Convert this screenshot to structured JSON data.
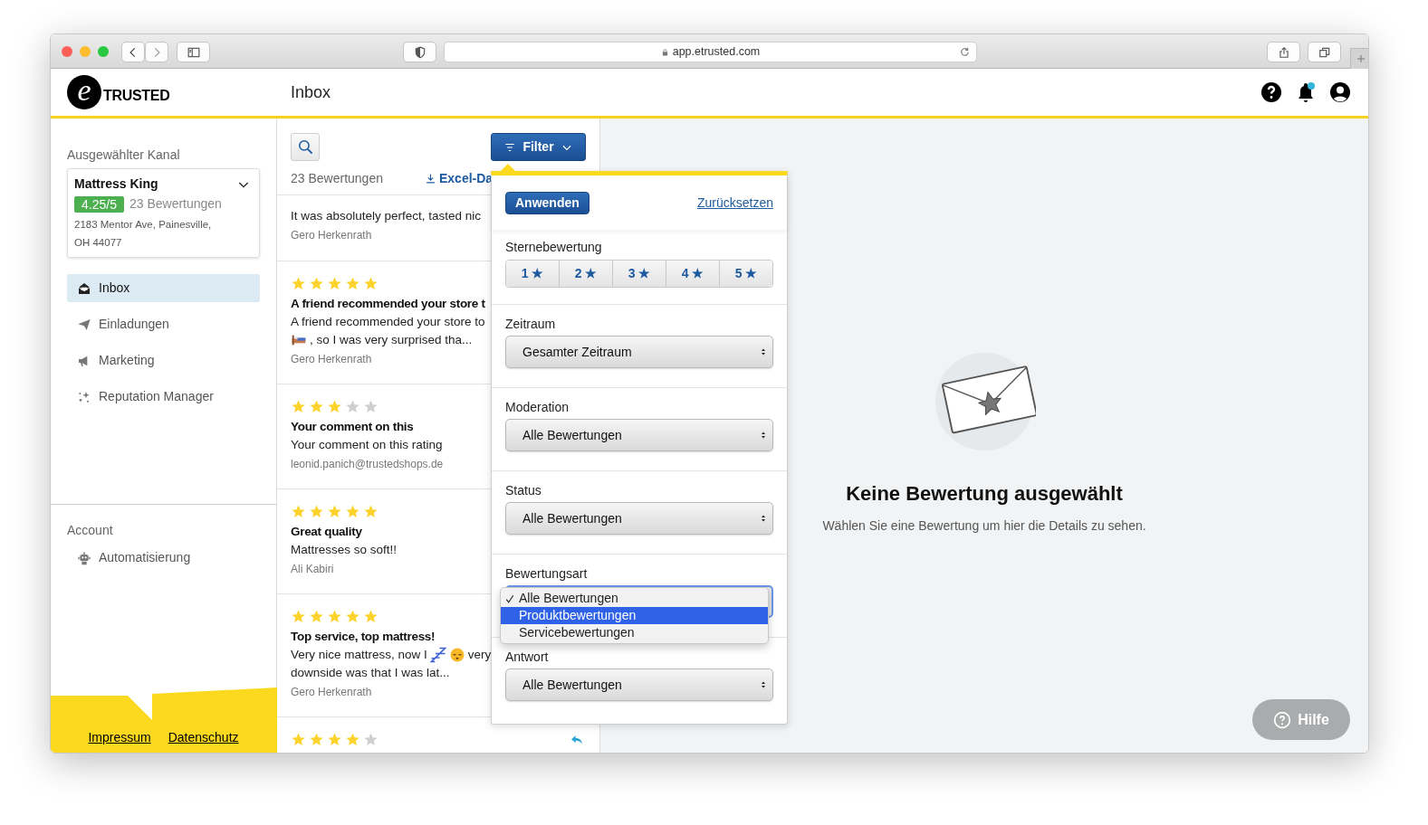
{
  "browser": {
    "url": "app.etrusted.com"
  },
  "header": {
    "logo": {
      "mark": "e",
      "text": "TRUSTED"
    },
    "title": "Inbox",
    "notification": true
  },
  "sidebar": {
    "channel_label": "Ausgewählter Kanal",
    "channel": {
      "name": "Mattress King",
      "rating": "4.25/5",
      "count": "23 Bewertungen",
      "address": "2183 Mentor Ave, Painesville, OH 44077"
    },
    "nav": [
      {
        "label": "Inbox",
        "selected": true
      },
      {
        "label": "Einladungen",
        "selected": false
      },
      {
        "label": "Marketing",
        "selected": false
      },
      {
        "label": "Reputation Manager",
        "selected": false
      }
    ],
    "account_label": "Account",
    "account_nav": [
      {
        "label": "Automatisierung",
        "selected": false
      }
    ],
    "footer_links": [
      "Impressum",
      "Datenschutz"
    ]
  },
  "review_list": {
    "count": "23 Bewertungen",
    "export_link": "Excel-Da",
    "filter_button": "Filter",
    "reviews": [
      {
        "body": [
          [
            {
              "text": "It was absolutely perfect, tasted nic"
            }
          ]
        ],
        "author": "Gero Herkenrath",
        "replied": false
      },
      {
        "stars": 5,
        "title": "A friend recommended your store t",
        "body": [
          [
            {
              "text": "A friend recommended your store to"
            }
          ],
          [
            {
              "kind": "emoji"
            },
            {
              "text": ", so I was very surprised tha..."
            }
          ]
        ],
        "author": "Gero Herkenrath",
        "replied": false
      },
      {
        "stars": 3,
        "title": "Your comment on this",
        "body": [
          [
            {
              "text": "Your comment on this rating"
            }
          ]
        ],
        "author": "leonid.panich@trustedshops.de",
        "replied": false
      },
      {
        "stars": 5,
        "title": "Great quality",
        "body": [
          [
            {
              "text": "Mattresses so soft!!"
            }
          ]
        ],
        "author": "Ali Kabiri",
        "replied": false
      },
      {
        "stars": 5,
        "title": "Top service, top mattress!",
        "body": [
          [
            {
              "text": "Very nice mattress, now I"
            },
            {
              "kind": "emoji"
            },
            {
              "kind": "emoji"
            },
            {
              "text": "very"
            }
          ],
          [
            {
              "text": "downside was that I was lat..."
            }
          ]
        ],
        "author": "Gero Herkenrath",
        "replied": false
      },
      {
        "stars": 4,
        "replied": true
      }
    ]
  },
  "filter": {
    "apply_button": "Anwenden",
    "reset_link": "Zurücksetzen",
    "star_filter": {
      "label": "Sternebewertung",
      "options": [
        {
          "label": "1 ★",
          "selected": false
        },
        {
          "label": "2 ★",
          "selected": false
        },
        {
          "label": "3 ★",
          "selected": false
        },
        {
          "label": "4 ★",
          "selected": false
        },
        {
          "label": "5 ★",
          "selected": false
        }
      ]
    },
    "selects": [
      {
        "label": "Zeitraum",
        "value": "Gesamter Zeitraum",
        "open": false
      },
      {
        "label": "Moderation",
        "value": "Alle Bewertungen",
        "open": false
      },
      {
        "label": "Status",
        "value": "Alle Bewertungen",
        "open": false
      },
      {
        "label": "Bewertungsart",
        "open": true,
        "options": [
          {
            "label": "Alle Bewertungen",
            "checked": true,
            "selected": false
          },
          {
            "label": "Produktbewertungen",
            "checked": false,
            "selected": true
          },
          {
            "label": "Servicebewertungen",
            "checked": false,
            "selected": false
          }
        ]
      },
      {
        "label": "Antwort",
        "value": "Alle Bewertungen",
        "open": false
      }
    ]
  },
  "detail": {
    "title": "Keine Bewertung ausgewählt",
    "subtitle": "Wählen Sie eine Bewertung um hier die Details zu sehen.",
    "help_button": "Hilfe"
  }
}
